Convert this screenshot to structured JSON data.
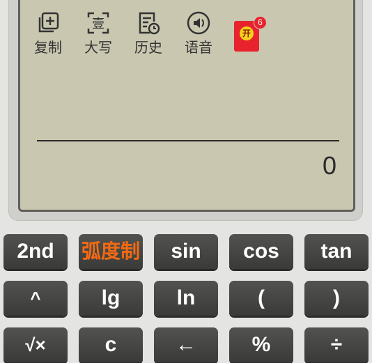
{
  "toolbar": {
    "copy": "复制",
    "uppercase": "大写",
    "history": "历史",
    "voice": "语音",
    "uppercase_glyph": "壹",
    "redpack_glyph": "开",
    "redpack_badge": "6"
  },
  "display": {
    "result": "0"
  },
  "keys": {
    "row1": [
      "2nd",
      "弧度制",
      "sin",
      "cos",
      "tan"
    ],
    "row2": [
      "^",
      "lg",
      "ln",
      "(",
      ")"
    ],
    "row3": [
      "√×",
      "c",
      "←",
      "%",
      "÷"
    ]
  },
  "colors": {
    "screen": "#c9c7b0",
    "key": "#454543",
    "accent_orange": "#f26a12",
    "red_packet": "#e8232e"
  }
}
